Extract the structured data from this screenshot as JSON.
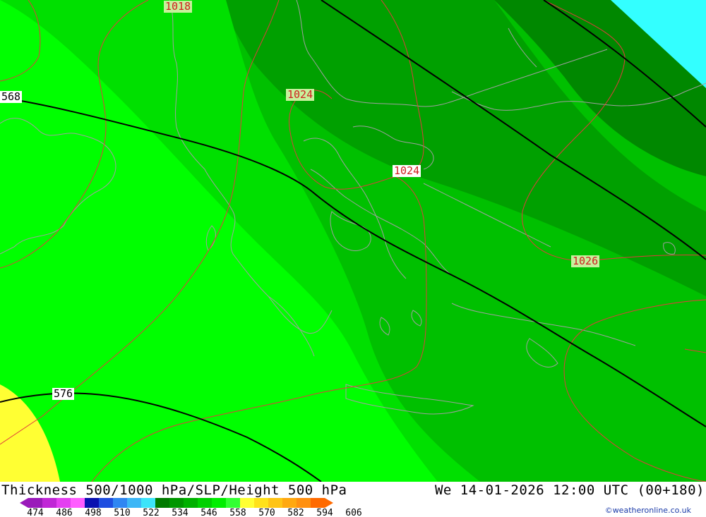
{
  "map": {
    "title_left": "Thickness 500/1000 hPa/SLP/Height 500 hPa",
    "title_right": "We 14-01-2026 12:00 UTC (00+180)",
    "credit": "©weatheronline.co.uk",
    "slp_labels": [
      "1018",
      "1024",
      "1024",
      "1026"
    ],
    "height_labels": [
      "568",
      "576"
    ],
    "colors": {
      "thickness_558": "#00ff00",
      "thickness_552": "#00e000",
      "thickness_546": "#00c000",
      "thickness_540": "#00a000",
      "thickness_534": "#008800",
      "thickness_564": "#ffff33",
      "sea_cyan": "#33ffff",
      "slp_isobar": "#e03c3c",
      "height_contour": "#000000",
      "coastline": "#a0a0a0"
    }
  },
  "legend": {
    "ticks": [
      "474",
      "486",
      "498",
      "510",
      "522",
      "534",
      "546",
      "558",
      "570",
      "582",
      "594",
      "606"
    ],
    "colors": [
      "#9a1aba",
      "#c026d6",
      "#e43ff0",
      "#ff5cff",
      "#0a10b0",
      "#1f4ee0",
      "#2f86f2",
      "#3cb6f6",
      "#3ce4fa",
      "#007a00",
      "#009600",
      "#00b000",
      "#00d000",
      "#00ee00",
      "#33ff33",
      "#ffff33",
      "#ffe11a",
      "#ffc415",
      "#ffa810",
      "#ff9010",
      "#ff6a00"
    ]
  }
}
